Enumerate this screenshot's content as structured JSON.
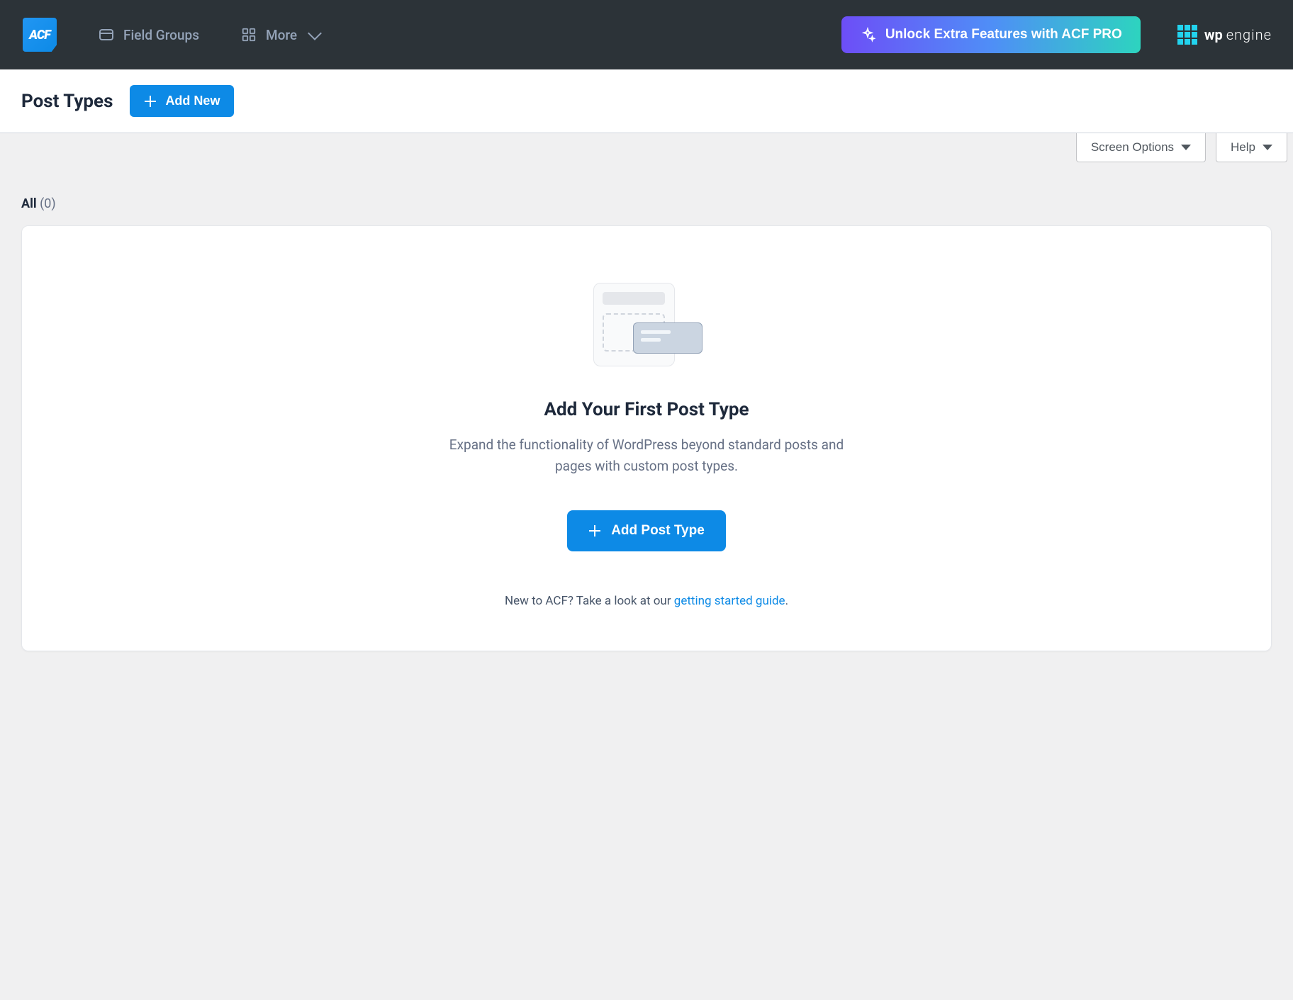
{
  "topbar": {
    "logo_text": "ACF",
    "nav": {
      "field_groups": "Field Groups",
      "more": "More"
    },
    "unlock_label": "Unlock Extra Features with ACF PRO",
    "wp_engine_bold": "wp",
    "wp_engine_light": "engine"
  },
  "page_header": {
    "title": "Post Types",
    "add_new_label": "Add New"
  },
  "tabs": {
    "screen_options": "Screen Options",
    "help": "Help"
  },
  "filter": {
    "all_label": "All",
    "count": "(0)"
  },
  "empty": {
    "title": "Add Your First Post Type",
    "description": "Expand the functionality of WordPress beyond standard posts and pages with custom post types.",
    "button_label": "Add Post Type",
    "help_prefix": "New to ACF? Take a look at our ",
    "help_link_text": "getting started guide",
    "help_suffix": "."
  }
}
